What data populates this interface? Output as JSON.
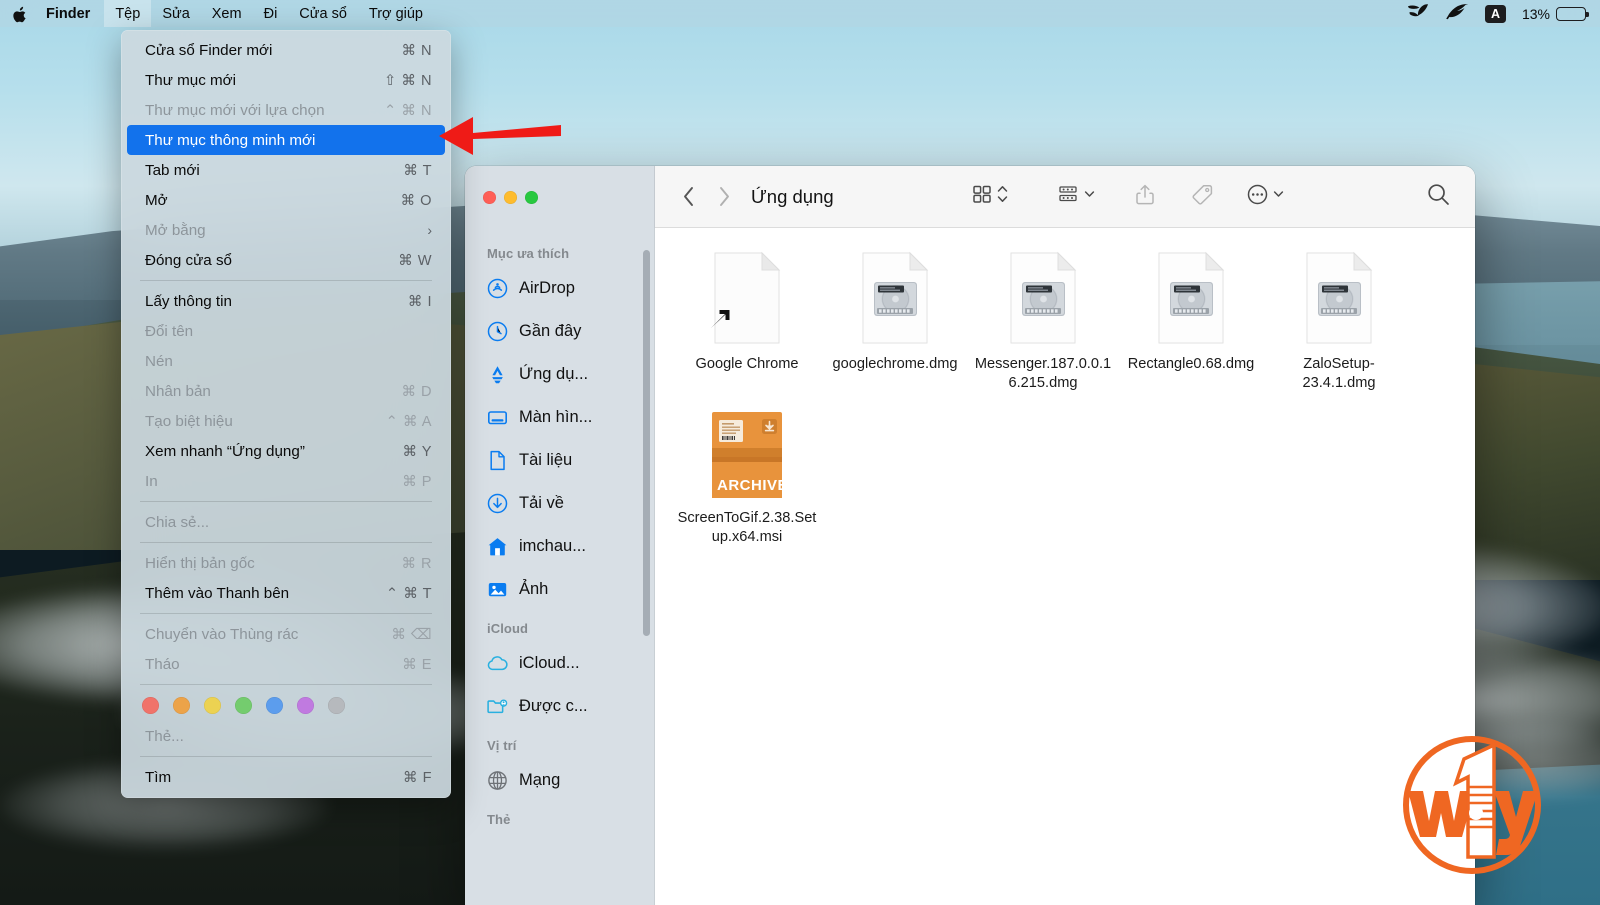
{
  "menubar": {
    "apple_icon": "apple-logo",
    "items": [
      {
        "label": "Finder",
        "bold": true,
        "active": false
      },
      {
        "label": "Tệp",
        "bold": false,
        "active": true
      },
      {
        "label": "Sửa",
        "bold": false,
        "active": false
      },
      {
        "label": "Xem",
        "bold": false,
        "active": false
      },
      {
        "label": "Đi",
        "bold": false,
        "active": false
      },
      {
        "label": "Cửa sổ",
        "bold": false,
        "active": false
      },
      {
        "label": "Trợ giúp",
        "bold": false,
        "active": false
      }
    ],
    "status": {
      "leaf_icon": "leaf-icon",
      "feather_icon": "feather-icon",
      "input_source": "A",
      "battery_percent": "13%",
      "battery_level": 13
    }
  },
  "file_menu": {
    "items": [
      {
        "label": "Cửa sổ Finder mới",
        "shortcut": "⌘ N",
        "state": "enabled"
      },
      {
        "label": "Thư mục mới",
        "shortcut": "⇧ ⌘ N",
        "state": "enabled"
      },
      {
        "label": "Thư mục mới với lựa chọn",
        "shortcut": "⌃ ⌘ N",
        "state": "disabled"
      },
      {
        "label": "Thư mục thông minh mới",
        "shortcut": "",
        "state": "selected"
      },
      {
        "label": "Tab mới",
        "shortcut": "⌘ T",
        "state": "enabled"
      },
      {
        "label": "Mở",
        "shortcut": "⌘ O",
        "state": "enabled"
      },
      {
        "label": "Mở bằng",
        "shortcut": "›",
        "state": "disabled",
        "submenu": true
      },
      {
        "label": "Đóng cửa sổ",
        "shortcut": "⌘ W",
        "state": "enabled"
      },
      {
        "type": "separator"
      },
      {
        "label": "Lấy thông tin",
        "shortcut": "⌘ I",
        "state": "enabled"
      },
      {
        "label": "Đổi tên",
        "shortcut": "",
        "state": "disabled"
      },
      {
        "label": "Nén",
        "shortcut": "",
        "state": "disabled"
      },
      {
        "label": "Nhân bản",
        "shortcut": "⌘ D",
        "state": "disabled"
      },
      {
        "label": "Tạo biệt hiệu",
        "shortcut": "⌃ ⌘ A",
        "state": "disabled"
      },
      {
        "label": "Xem nhanh “Ứng dụng”",
        "shortcut": "⌘ Y",
        "state": "enabled"
      },
      {
        "label": "In",
        "shortcut": "⌘ P",
        "state": "disabled"
      },
      {
        "type": "separator"
      },
      {
        "label": "Chia sẻ...",
        "shortcut": "",
        "state": "disabled"
      },
      {
        "type": "separator"
      },
      {
        "label": "Hiển thị bản gốc",
        "shortcut": "⌘ R",
        "state": "disabled"
      },
      {
        "label": "Thêm vào Thanh bên",
        "shortcut": "⌃ ⌘ T",
        "state": "enabled"
      },
      {
        "type": "separator"
      },
      {
        "label": "Chuyển vào Thùng rác",
        "shortcut": "⌘ ⌫",
        "state": "disabled"
      },
      {
        "label": "Tháo",
        "shortcut": "⌘ E",
        "state": "disabled"
      },
      {
        "type": "separator"
      },
      {
        "type": "tags"
      },
      {
        "label": "Thẻ...",
        "shortcut": "",
        "state": "disabled"
      },
      {
        "type": "separator"
      },
      {
        "label": "Tìm",
        "shortcut": "⌘ F",
        "state": "enabled"
      }
    ],
    "tag_colors": [
      "#f0736a",
      "#eca349",
      "#ecd252",
      "#74cc6e",
      "#5c9ded",
      "#c07ae0",
      "#b6b9bd"
    ]
  },
  "annotation": {
    "arrow_color": "#ef1b17",
    "arrow_target": "Thư mục thông minh mới"
  },
  "finder": {
    "title": "Ứng dụng",
    "traffic_lights": [
      "close-button",
      "minimize-button",
      "maximize-button"
    ],
    "toolbar": {
      "back_icon": "chevron-left-icon",
      "forward_icon": "chevron-right-icon",
      "view_icon": "grid-view-icon",
      "group_icon": "group-by-icon",
      "share_icon": "share-icon",
      "tag_icon": "tag-icon",
      "more_icon": "more-ellipsis-icon",
      "search_icon": "search-icon"
    },
    "sidebar": {
      "sections": [
        {
          "header": "Mục ưa thích",
          "items": [
            {
              "label": "AirDrop",
              "icon": "airdrop-icon",
              "color": "#0a7cf0"
            },
            {
              "label": "Gần đây",
              "icon": "clock-icon",
              "color": "#0a7cf0"
            },
            {
              "label": "Ứng dụ...",
              "icon": "applications-icon",
              "color": "#0a7cf0"
            },
            {
              "label": "Màn hìn...",
              "icon": "desktop-icon",
              "color": "#0a7cf0"
            },
            {
              "label": "Tài liệu",
              "icon": "document-icon",
              "color": "#0a7cf0"
            },
            {
              "label": "Tải về",
              "icon": "download-icon",
              "color": "#0a7cf0"
            },
            {
              "label": "imchau...",
              "icon": "home-icon",
              "color": "#0a7cf0"
            },
            {
              "label": "Ảnh",
              "icon": "photos-icon",
              "color": "#0a7cf0"
            }
          ]
        },
        {
          "header": "iCloud",
          "items": [
            {
              "label": "iCloud...",
              "icon": "icloud-icon",
              "color": "#29b0e0"
            },
            {
              "label": "Được c...",
              "icon": "shared-folder-icon",
              "color": "#29b0e0"
            }
          ]
        },
        {
          "header": "Vị trí",
          "items": [
            {
              "label": "Mạng",
              "icon": "network-globe-icon",
              "color": "#6e7277"
            }
          ]
        },
        {
          "header": "Thẻ",
          "items": []
        }
      ]
    },
    "files": [
      {
        "name": "Google Chrome",
        "icon": "blank-document-icon",
        "alias": true
      },
      {
        "name": "googlechrome.dmg",
        "icon": "disk-image-icon",
        "alias": false
      },
      {
        "name": "Messenger.187.0.0.16.215.dmg",
        "icon": "disk-image-icon",
        "alias": false
      },
      {
        "name": "Rectangle0.68.dmg",
        "icon": "disk-image-icon",
        "alias": false
      },
      {
        "name": "ZaloSetup-23.4.1.dmg",
        "icon": "disk-image-icon",
        "alias": false
      },
      {
        "name": "ScreenToGif.2.38.Setup.x64.msi",
        "icon": "archive-icon",
        "archive_label": "ARCHIVE",
        "alias": false
      }
    ]
  },
  "watermark": {
    "text": "w1ay",
    "color": "#ef6722"
  }
}
